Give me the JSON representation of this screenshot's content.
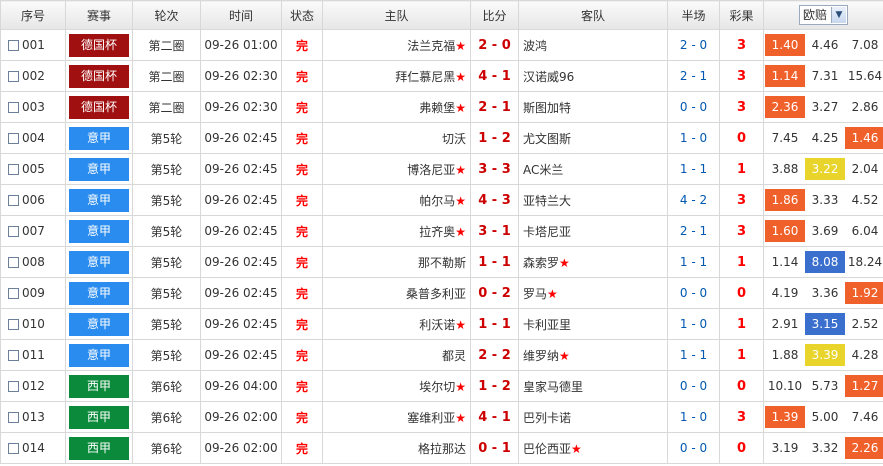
{
  "headers": {
    "idx": "序号",
    "league": "赛事",
    "round": "轮次",
    "time": "时间",
    "status": "状态",
    "home": "主队",
    "score": "比分",
    "away": "客队",
    "half": "半场",
    "lottery": "彩果"
  },
  "odds_select": {
    "value": "欧赔"
  },
  "colors": {
    "dfb_cup": "#a01010",
    "serie_a": "#2b8cf0",
    "la_liga": "#0a8a3a",
    "highlight_orange": "#f0602a",
    "highlight_yellow": "#e8d42a",
    "highlight_blue": "#3a6fce"
  },
  "rows": [
    {
      "idx": "001",
      "league": "德国杯",
      "league_color": "#a01010",
      "round": "第二圈",
      "time": "09-26 01:00",
      "status": "完",
      "home": "法兰克福",
      "home_star": "★",
      "score": "2 - 0",
      "away": "波鸿",
      "away_star": "",
      "half": "2 - 0",
      "lottery": "3",
      "o1": "1.40",
      "o2": "4.46",
      "o3": "7.08",
      "hl": 1,
      "hl_color": "orange"
    },
    {
      "idx": "002",
      "league": "德国杯",
      "league_color": "#a01010",
      "round": "第二圈",
      "time": "09-26 02:30",
      "status": "完",
      "home": "拜仁慕尼黑",
      "home_star": "★",
      "score": "4 - 1",
      "away": "汉诺威96",
      "away_star": "",
      "half": "2 - 1",
      "lottery": "3",
      "o1": "1.14",
      "o2": "7.31",
      "o3": "15.64",
      "hl": 1,
      "hl_color": "orange"
    },
    {
      "idx": "003",
      "league": "德国杯",
      "league_color": "#a01010",
      "round": "第二圈",
      "time": "09-26 02:30",
      "status": "完",
      "home": "弗赖堡",
      "home_star": "★",
      "score": "2 - 1",
      "away": "斯图加特",
      "away_star": "",
      "half": "0 - 0",
      "lottery": "3",
      "o1": "2.36",
      "o2": "3.27",
      "o3": "2.86",
      "hl": 1,
      "hl_color": "orange"
    },
    {
      "idx": "004",
      "league": "意甲",
      "league_color": "#2b8cf0",
      "round": "第5轮",
      "time": "09-26 02:45",
      "status": "完",
      "home": "切沃",
      "home_star": "",
      "score": "1 - 2",
      "away": "尤文图斯",
      "away_star": "",
      "half": "1 - 0",
      "lottery": "0",
      "o1": "7.45",
      "o2": "4.25",
      "o3": "1.46",
      "hl": 3,
      "hl_color": "orange"
    },
    {
      "idx": "005",
      "league": "意甲",
      "league_color": "#2b8cf0",
      "round": "第5轮",
      "time": "09-26 02:45",
      "status": "完",
      "home": "博洛尼亚",
      "home_star": "★",
      "score": "3 - 3",
      "away": "AC米兰",
      "away_star": "",
      "half": "1 - 1",
      "lottery": "1",
      "o1": "3.88",
      "o2": "3.22",
      "o3": "2.04",
      "hl": 2,
      "hl_color": "yellow"
    },
    {
      "idx": "006",
      "league": "意甲",
      "league_color": "#2b8cf0",
      "round": "第5轮",
      "time": "09-26 02:45",
      "status": "完",
      "home": "帕尔马",
      "home_star": "★",
      "score": "4 - 3",
      "away": "亚特兰大",
      "away_star": "",
      "half": "4 - 2",
      "lottery": "3",
      "o1": "1.86",
      "o2": "3.33",
      "o3": "4.52",
      "hl": 1,
      "hl_color": "orange"
    },
    {
      "idx": "007",
      "league": "意甲",
      "league_color": "#2b8cf0",
      "round": "第5轮",
      "time": "09-26 02:45",
      "status": "完",
      "home": "拉齐奥",
      "home_star": "★",
      "score": "3 - 1",
      "away": "卡塔尼亚",
      "away_star": "",
      "half": "2 - 1",
      "lottery": "3",
      "o1": "1.60",
      "o2": "3.69",
      "o3": "6.04",
      "hl": 1,
      "hl_color": "orange"
    },
    {
      "idx": "008",
      "league": "意甲",
      "league_color": "#2b8cf0",
      "round": "第5轮",
      "time": "09-26 02:45",
      "status": "完",
      "home": "那不勒斯",
      "home_star": "",
      "score": "1 - 1",
      "away": "森索罗",
      "away_star": "★",
      "half": "1 - 1",
      "lottery": "1",
      "o1": "1.14",
      "o2": "8.08",
      "o3": "18.24",
      "hl": 2,
      "hl_color": "blue"
    },
    {
      "idx": "009",
      "league": "意甲",
      "league_color": "#2b8cf0",
      "round": "第5轮",
      "time": "09-26 02:45",
      "status": "完",
      "home": "桑普多利亚",
      "home_star": "",
      "score": "0 - 2",
      "away": "罗马",
      "away_star": "★",
      "half": "0 - 0",
      "lottery": "0",
      "o1": "4.19",
      "o2": "3.36",
      "o3": "1.92",
      "hl": 3,
      "hl_color": "orange"
    },
    {
      "idx": "010",
      "league": "意甲",
      "league_color": "#2b8cf0",
      "round": "第5轮",
      "time": "09-26 02:45",
      "status": "完",
      "home": "利沃诺",
      "home_star": "★",
      "score": "1 - 1",
      "away": "卡利亚里",
      "away_star": "",
      "half": "1 - 0",
      "lottery": "1",
      "o1": "2.91",
      "o2": "3.15",
      "o3": "2.52",
      "hl": 2,
      "hl_color": "blue"
    },
    {
      "idx": "011",
      "league": "意甲",
      "league_color": "#2b8cf0",
      "round": "第5轮",
      "time": "09-26 02:45",
      "status": "完",
      "home": "都灵",
      "home_star": "",
      "score": "2 - 2",
      "away": "维罗纳",
      "away_star": "★",
      "half": "1 - 1",
      "lottery": "1",
      "o1": "1.88",
      "o2": "3.39",
      "o3": "4.28",
      "hl": 2,
      "hl_color": "yellow"
    },
    {
      "idx": "012",
      "league": "西甲",
      "league_color": "#0a8a3a",
      "round": "第6轮",
      "time": "09-26 04:00",
      "status": "完",
      "home": "埃尔切",
      "home_star": "★",
      "score": "1 - 2",
      "away": "皇家马德里",
      "away_star": "",
      "half": "0 - 0",
      "lottery": "0",
      "o1": "10.10",
      "o2": "5.73",
      "o3": "1.27",
      "hl": 3,
      "hl_color": "orange"
    },
    {
      "idx": "013",
      "league": "西甲",
      "league_color": "#0a8a3a",
      "round": "第6轮",
      "time": "09-26 02:00",
      "status": "完",
      "home": "塞维利亚",
      "home_star": "★",
      "score": "4 - 1",
      "away": "巴列卡诺",
      "away_star": "",
      "half": "1 - 0",
      "lottery": "3",
      "o1": "1.39",
      "o2": "5.00",
      "o3": "7.46",
      "hl": 1,
      "hl_color": "orange"
    },
    {
      "idx": "014",
      "league": "西甲",
      "league_color": "#0a8a3a",
      "round": "第6轮",
      "time": "09-26 02:00",
      "status": "完",
      "home": "格拉那达",
      "home_star": "",
      "score": "0 - 1",
      "away": "巴伦西亚",
      "away_star": "★",
      "half": "0 - 0",
      "lottery": "0",
      "o1": "3.19",
      "o2": "3.32",
      "o3": "2.26",
      "hl": 3,
      "hl_color": "orange"
    }
  ]
}
